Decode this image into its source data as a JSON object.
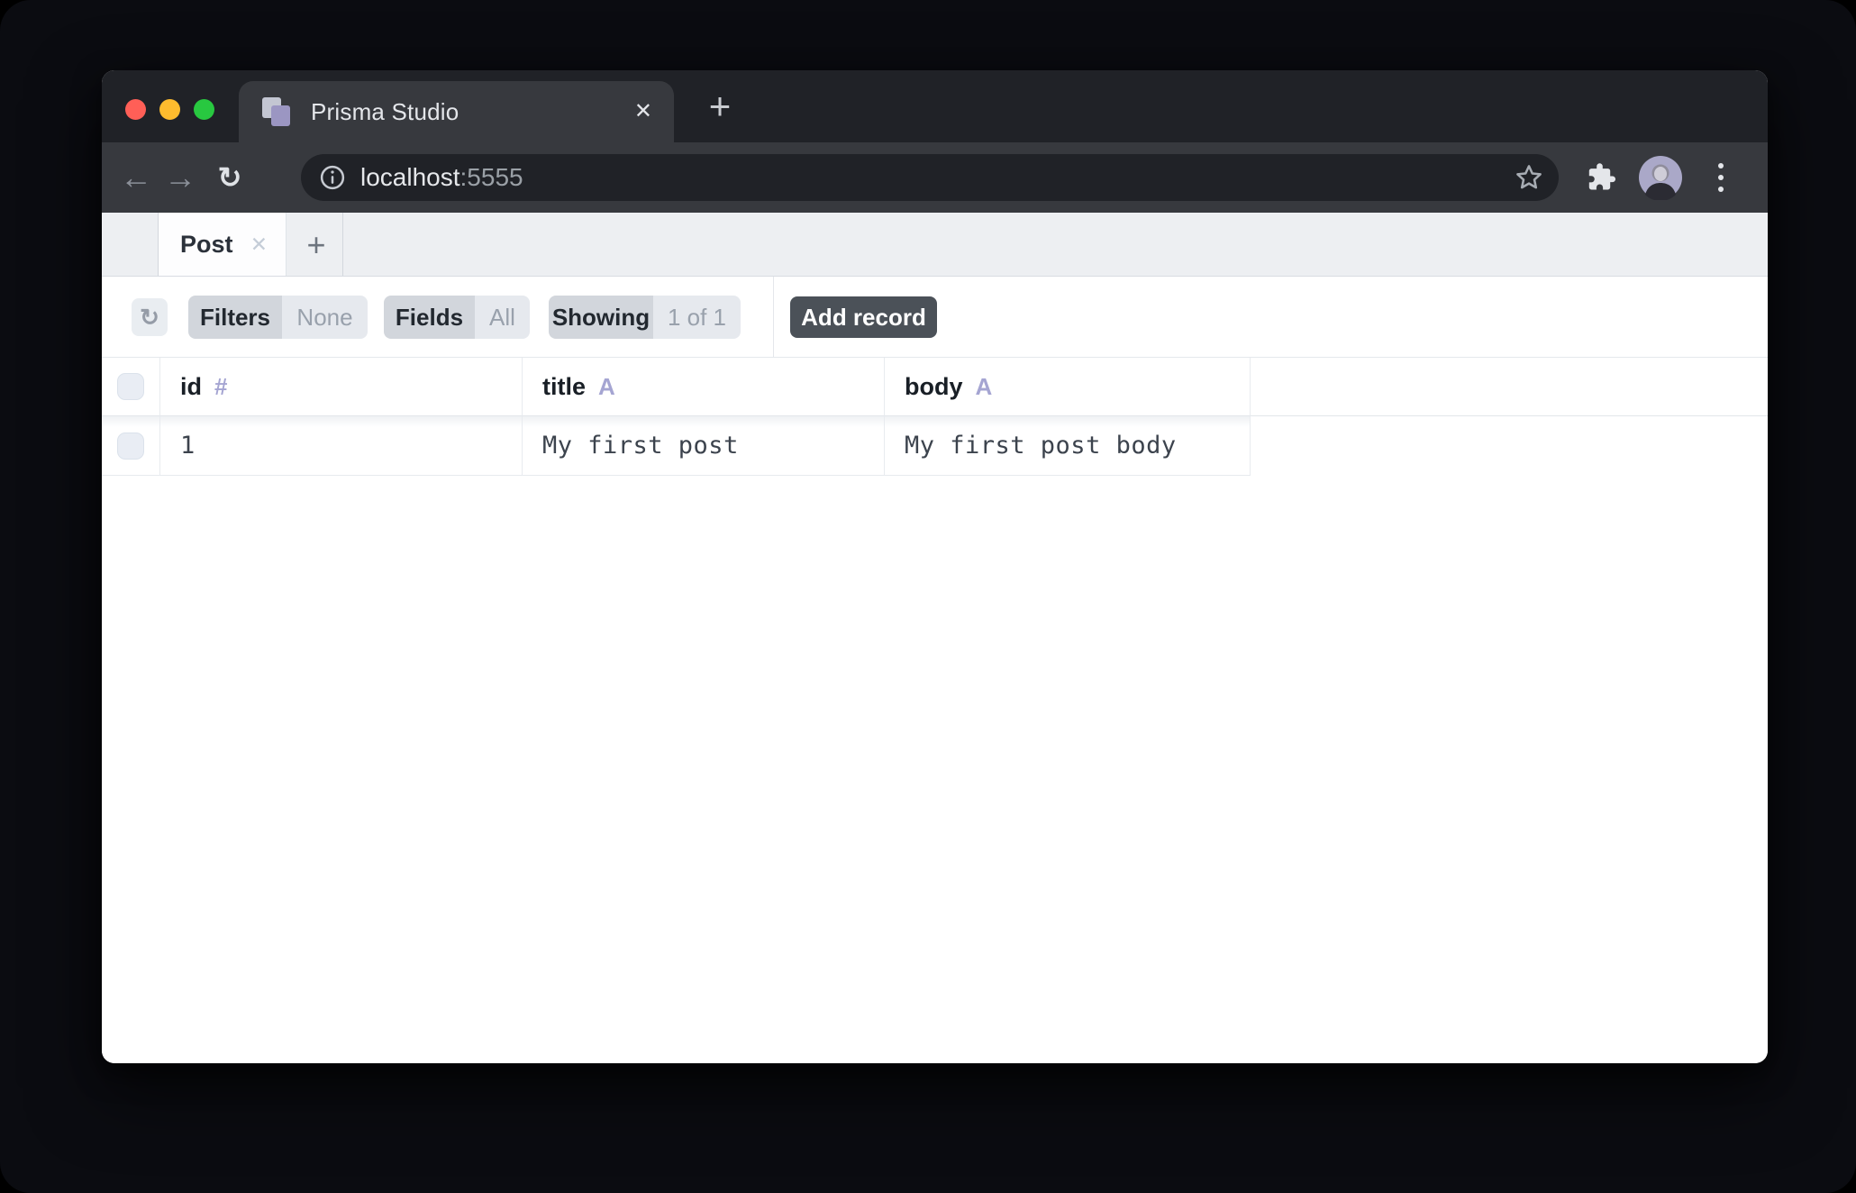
{
  "browser": {
    "tab": {
      "title": "Prisma Studio",
      "close_glyph": "✕"
    },
    "new_tab_glyph": "+",
    "nav": {
      "back_glyph": "←",
      "forward_glyph": "→",
      "reload_glyph": "↻"
    },
    "address": {
      "host": "localhost",
      "port": ":5555"
    }
  },
  "studio": {
    "model_tab": {
      "label": "Post",
      "close_glyph": "✕"
    },
    "add_tab_glyph": "+",
    "toolbar": {
      "refresh_glyph": "↻",
      "filters_label": "Filters",
      "filters_value": "None",
      "fields_label": "Fields",
      "fields_value": "All",
      "showing_label": "Showing",
      "showing_value": "1 of 1",
      "add_record_label": "Add record"
    },
    "table": {
      "columns": [
        {
          "name": "id",
          "type_symbol": "#"
        },
        {
          "name": "title",
          "type_symbol": "A"
        },
        {
          "name": "body",
          "type_symbol": "A"
        }
      ],
      "rows": [
        {
          "id": "1",
          "title": "My first post",
          "body": "My first post body"
        }
      ]
    }
  },
  "colors": {
    "chrome_dark": "#202227",
    "chrome_toolbar": "#37393e",
    "studio_tabbar_bg": "#edeff2",
    "segment_label_bg": "#d2d6dc",
    "segment_value_bg": "#e6e9ee",
    "add_record_bg": "#4b5158",
    "field_type_lavender": "#a5a5d2",
    "traffic_red": "#ff5f57",
    "traffic_yellow": "#febc2e",
    "traffic_green": "#28c840"
  }
}
